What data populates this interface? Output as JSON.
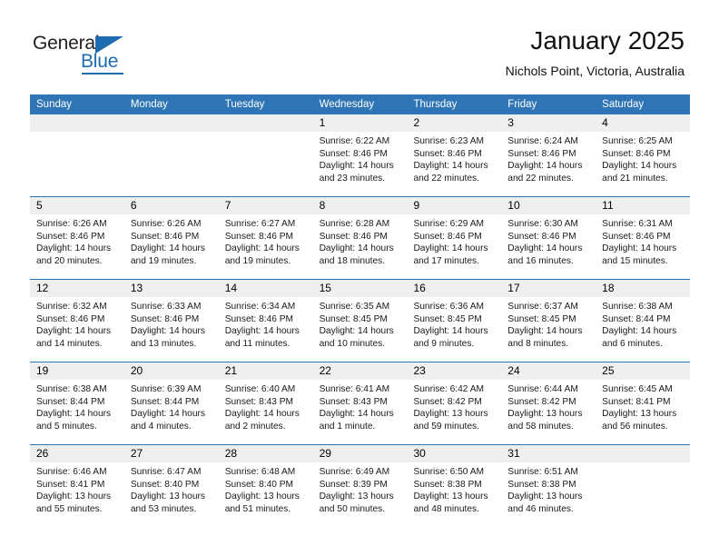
{
  "brand": {
    "name_top": "General",
    "name_bottom": "Blue",
    "accent_color": "#1f6bb0"
  },
  "header": {
    "title": "January 2025",
    "subtitle": "Nichols Point, Victoria, Australia"
  },
  "calendar": {
    "header_bg": "#2f75b5",
    "daynum_bg": "#efefef",
    "weekdays": [
      "Sunday",
      "Monday",
      "Tuesday",
      "Wednesday",
      "Thursday",
      "Friday",
      "Saturday"
    ],
    "weeks": [
      [
        {
          "day": "",
          "sunrise": "",
          "sunset": "",
          "daylight": "",
          "daylight2": ""
        },
        {
          "day": "",
          "sunrise": "",
          "sunset": "",
          "daylight": "",
          "daylight2": ""
        },
        {
          "day": "",
          "sunrise": "",
          "sunset": "",
          "daylight": "",
          "daylight2": ""
        },
        {
          "day": "1",
          "sunrise": "Sunrise: 6:22 AM",
          "sunset": "Sunset: 8:46 PM",
          "daylight": "Daylight: 14 hours",
          "daylight2": "and 23 minutes."
        },
        {
          "day": "2",
          "sunrise": "Sunrise: 6:23 AM",
          "sunset": "Sunset: 8:46 PM",
          "daylight": "Daylight: 14 hours",
          "daylight2": "and 22 minutes."
        },
        {
          "day": "3",
          "sunrise": "Sunrise: 6:24 AM",
          "sunset": "Sunset: 8:46 PM",
          "daylight": "Daylight: 14 hours",
          "daylight2": "and 22 minutes."
        },
        {
          "day": "4",
          "sunrise": "Sunrise: 6:25 AM",
          "sunset": "Sunset: 8:46 PM",
          "daylight": "Daylight: 14 hours",
          "daylight2": "and 21 minutes."
        }
      ],
      [
        {
          "day": "5",
          "sunrise": "Sunrise: 6:26 AM",
          "sunset": "Sunset: 8:46 PM",
          "daylight": "Daylight: 14 hours",
          "daylight2": "and 20 minutes."
        },
        {
          "day": "6",
          "sunrise": "Sunrise: 6:26 AM",
          "sunset": "Sunset: 8:46 PM",
          "daylight": "Daylight: 14 hours",
          "daylight2": "and 19 minutes."
        },
        {
          "day": "7",
          "sunrise": "Sunrise: 6:27 AM",
          "sunset": "Sunset: 8:46 PM",
          "daylight": "Daylight: 14 hours",
          "daylight2": "and 19 minutes."
        },
        {
          "day": "8",
          "sunrise": "Sunrise: 6:28 AM",
          "sunset": "Sunset: 8:46 PM",
          "daylight": "Daylight: 14 hours",
          "daylight2": "and 18 minutes."
        },
        {
          "day": "9",
          "sunrise": "Sunrise: 6:29 AM",
          "sunset": "Sunset: 8:46 PM",
          "daylight": "Daylight: 14 hours",
          "daylight2": "and 17 minutes."
        },
        {
          "day": "10",
          "sunrise": "Sunrise: 6:30 AM",
          "sunset": "Sunset: 8:46 PM",
          "daylight": "Daylight: 14 hours",
          "daylight2": "and 16 minutes."
        },
        {
          "day": "11",
          "sunrise": "Sunrise: 6:31 AM",
          "sunset": "Sunset: 8:46 PM",
          "daylight": "Daylight: 14 hours",
          "daylight2": "and 15 minutes."
        }
      ],
      [
        {
          "day": "12",
          "sunrise": "Sunrise: 6:32 AM",
          "sunset": "Sunset: 8:46 PM",
          "daylight": "Daylight: 14 hours",
          "daylight2": "and 14 minutes."
        },
        {
          "day": "13",
          "sunrise": "Sunrise: 6:33 AM",
          "sunset": "Sunset: 8:46 PM",
          "daylight": "Daylight: 14 hours",
          "daylight2": "and 13 minutes."
        },
        {
          "day": "14",
          "sunrise": "Sunrise: 6:34 AM",
          "sunset": "Sunset: 8:46 PM",
          "daylight": "Daylight: 14 hours",
          "daylight2": "and 11 minutes."
        },
        {
          "day": "15",
          "sunrise": "Sunrise: 6:35 AM",
          "sunset": "Sunset: 8:45 PM",
          "daylight": "Daylight: 14 hours",
          "daylight2": "and 10 minutes."
        },
        {
          "day": "16",
          "sunrise": "Sunrise: 6:36 AM",
          "sunset": "Sunset: 8:45 PM",
          "daylight": "Daylight: 14 hours",
          "daylight2": "and 9 minutes."
        },
        {
          "day": "17",
          "sunrise": "Sunrise: 6:37 AM",
          "sunset": "Sunset: 8:45 PM",
          "daylight": "Daylight: 14 hours",
          "daylight2": "and 8 minutes."
        },
        {
          "day": "18",
          "sunrise": "Sunrise: 6:38 AM",
          "sunset": "Sunset: 8:44 PM",
          "daylight": "Daylight: 14 hours",
          "daylight2": "and 6 minutes."
        }
      ],
      [
        {
          "day": "19",
          "sunrise": "Sunrise: 6:38 AM",
          "sunset": "Sunset: 8:44 PM",
          "daylight": "Daylight: 14 hours",
          "daylight2": "and 5 minutes."
        },
        {
          "day": "20",
          "sunrise": "Sunrise: 6:39 AM",
          "sunset": "Sunset: 8:44 PM",
          "daylight": "Daylight: 14 hours",
          "daylight2": "and 4 minutes."
        },
        {
          "day": "21",
          "sunrise": "Sunrise: 6:40 AM",
          "sunset": "Sunset: 8:43 PM",
          "daylight": "Daylight: 14 hours",
          "daylight2": "and 2 minutes."
        },
        {
          "day": "22",
          "sunrise": "Sunrise: 6:41 AM",
          "sunset": "Sunset: 8:43 PM",
          "daylight": "Daylight: 14 hours",
          "daylight2": "and 1 minute."
        },
        {
          "day": "23",
          "sunrise": "Sunrise: 6:42 AM",
          "sunset": "Sunset: 8:42 PM",
          "daylight": "Daylight: 13 hours",
          "daylight2": "and 59 minutes."
        },
        {
          "day": "24",
          "sunrise": "Sunrise: 6:44 AM",
          "sunset": "Sunset: 8:42 PM",
          "daylight": "Daylight: 13 hours",
          "daylight2": "and 58 minutes."
        },
        {
          "day": "25",
          "sunrise": "Sunrise: 6:45 AM",
          "sunset": "Sunset: 8:41 PM",
          "daylight": "Daylight: 13 hours",
          "daylight2": "and 56 minutes."
        }
      ],
      [
        {
          "day": "26",
          "sunrise": "Sunrise: 6:46 AM",
          "sunset": "Sunset: 8:41 PM",
          "daylight": "Daylight: 13 hours",
          "daylight2": "and 55 minutes."
        },
        {
          "day": "27",
          "sunrise": "Sunrise: 6:47 AM",
          "sunset": "Sunset: 8:40 PM",
          "daylight": "Daylight: 13 hours",
          "daylight2": "and 53 minutes."
        },
        {
          "day": "28",
          "sunrise": "Sunrise: 6:48 AM",
          "sunset": "Sunset: 8:40 PM",
          "daylight": "Daylight: 13 hours",
          "daylight2": "and 51 minutes."
        },
        {
          "day": "29",
          "sunrise": "Sunrise: 6:49 AM",
          "sunset": "Sunset: 8:39 PM",
          "daylight": "Daylight: 13 hours",
          "daylight2": "and 50 minutes."
        },
        {
          "day": "30",
          "sunrise": "Sunrise: 6:50 AM",
          "sunset": "Sunset: 8:38 PM",
          "daylight": "Daylight: 13 hours",
          "daylight2": "and 48 minutes."
        },
        {
          "day": "31",
          "sunrise": "Sunrise: 6:51 AM",
          "sunset": "Sunset: 8:38 PM",
          "daylight": "Daylight: 13 hours",
          "daylight2": "and 46 minutes."
        },
        {
          "day": "",
          "sunrise": "",
          "sunset": "",
          "daylight": "",
          "daylight2": ""
        }
      ]
    ]
  }
}
